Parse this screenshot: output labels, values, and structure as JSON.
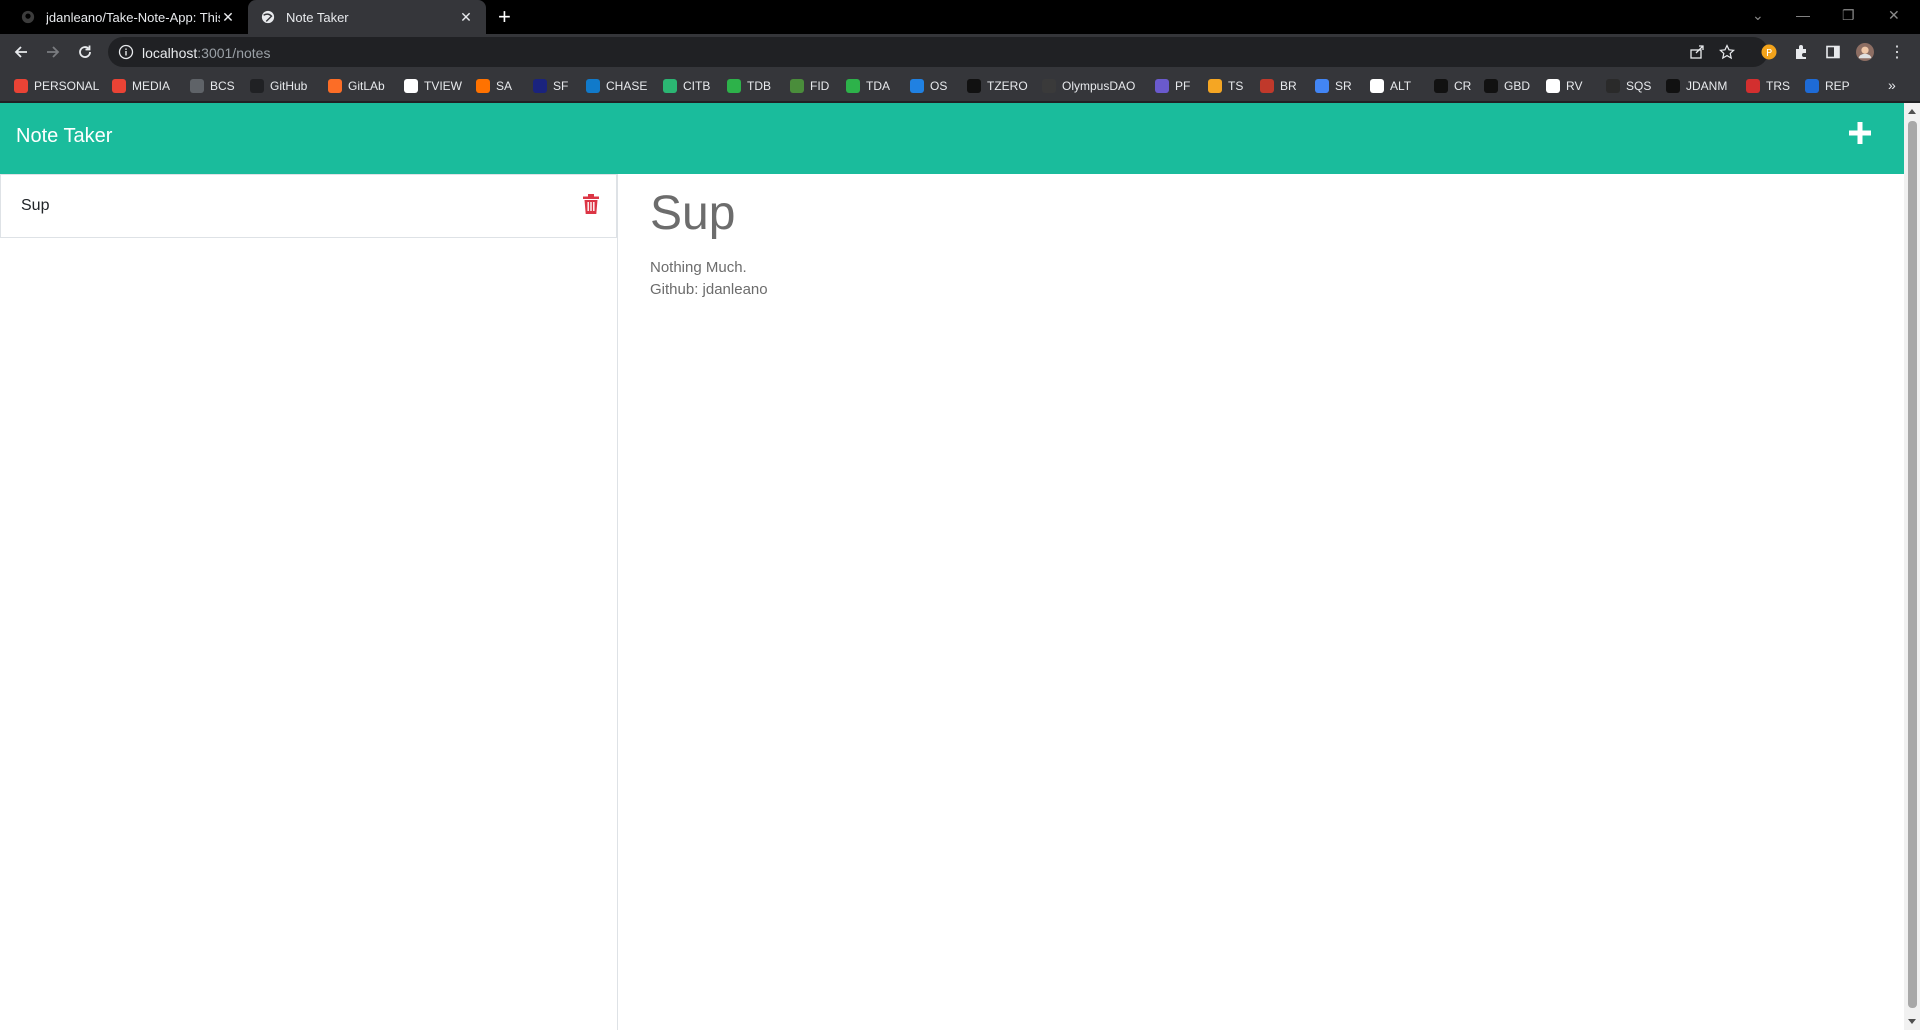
{
  "browser": {
    "tabs": [
      {
        "title": "jdanleano/Take-Note-App: This is",
        "icon": "github-icon",
        "active": false
      },
      {
        "title": "Note Taker",
        "icon": "globe-icon",
        "active": true
      }
    ],
    "new_tab_label": "+",
    "url_host": "localhost",
    "url_path": ":3001/notes",
    "bookmarks": [
      {
        "label": "PERSONAL",
        "icon": "gmail-icon",
        "color": "#ea4335"
      },
      {
        "label": "MEDIA",
        "icon": "gmail-icon",
        "color": "#ea4335"
      },
      {
        "label": "BCS",
        "icon": "globe-icon",
        "color": "#5f6368"
      },
      {
        "label": "GitHub",
        "icon": "github-icon",
        "color": "#202124"
      },
      {
        "label": "GitLAb",
        "icon": "gitlab-icon",
        "color": "#fc6d26"
      },
      {
        "label": "TVIEW",
        "icon": "tradingview-icon",
        "color": "#ffffff"
      },
      {
        "label": "SA",
        "icon": "sa-icon",
        "color": "#ff7200"
      },
      {
        "label": "SF",
        "icon": "sf-icon",
        "color": "#1a237e"
      },
      {
        "label": "CHASE",
        "icon": "chase-icon",
        "color": "#117aca"
      },
      {
        "label": "CITB",
        "icon": "citb-icon",
        "color": "#2bb673"
      },
      {
        "label": "TDB",
        "icon": "td-icon",
        "color": "#2db24a"
      },
      {
        "label": "FID",
        "icon": "fidelity-icon",
        "color": "#4a8d3b"
      },
      {
        "label": "TDA",
        "icon": "td-icon",
        "color": "#2db24a"
      },
      {
        "label": "OS",
        "icon": "opensea-icon",
        "color": "#2081e2"
      },
      {
        "label": "TZERO",
        "icon": "tzero-icon",
        "color": "#111111"
      },
      {
        "label": "OlympusDAO",
        "icon": "olympus-icon",
        "color": "#3a3a3a"
      },
      {
        "label": "PF",
        "icon": "pf-icon",
        "color": "#6a5acd"
      },
      {
        "label": "TS",
        "icon": "ts-icon",
        "color": "#f5a623"
      },
      {
        "label": "BR",
        "icon": "br-icon",
        "color": "#c0392b"
      },
      {
        "label": "SR",
        "icon": "sr-icon",
        "color": "#4285f4"
      },
      {
        "label": "ALT",
        "icon": "alt-icon",
        "color": "#ffffff"
      },
      {
        "label": "CR",
        "icon": "cr-icon",
        "color": "#111111"
      },
      {
        "label": "GBD",
        "icon": "gbd-icon",
        "color": "#111111"
      },
      {
        "label": "RV",
        "icon": "rv-icon",
        "color": "#ffffff"
      },
      {
        "label": "SQS",
        "icon": "sqs-icon",
        "color": "#2a2a2a"
      },
      {
        "label": "JDANM",
        "icon": "jdanm-icon",
        "color": "#111111"
      },
      {
        "label": "TRS",
        "icon": "trs-icon",
        "color": "#d32f2f"
      },
      {
        "label": "REP",
        "icon": "rep-icon",
        "color": "#1e6bd6"
      }
    ],
    "bookmarks_more": "»"
  },
  "app": {
    "brand": "Note Taker",
    "accent_color": "#1abc9c",
    "notes": [
      {
        "title": "Sup"
      }
    ],
    "active_note": {
      "title": "Sup",
      "body_lines": [
        "Nothing Much.",
        "Github: jdanleano"
      ]
    }
  }
}
